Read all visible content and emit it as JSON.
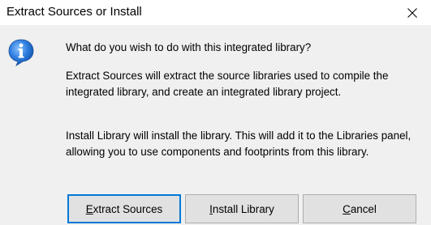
{
  "window": {
    "title": "Extract Sources or Install",
    "close_glyph": "close-icon"
  },
  "icon": {
    "name": "info-icon",
    "color_fill": "#1f6fd0",
    "color_glyph": "#ffffff"
  },
  "message": {
    "question": "What do you wish to do with this integrated library?",
    "extract_desc": "Extract Sources will extract the source libraries used to compile the integrated library, and create an integrated library project.",
    "install_desc": "Install Library will install the library. This will add it to the Libraries panel, allowing you to use components and footprints from this library."
  },
  "buttons": {
    "extract": {
      "mnemonic": "E",
      "rest": "xtract Sources"
    },
    "install": {
      "mnemonic": "I",
      "rest": "nstall Library"
    },
    "cancel": {
      "mnemonic": "C",
      "rest": "ancel"
    }
  },
  "colors": {
    "dialog_bg": "#f0f0f0",
    "titlebar_bg": "#ffffff",
    "default_button_border": "#0078d7",
    "button_bg": "#e1e1e1"
  }
}
